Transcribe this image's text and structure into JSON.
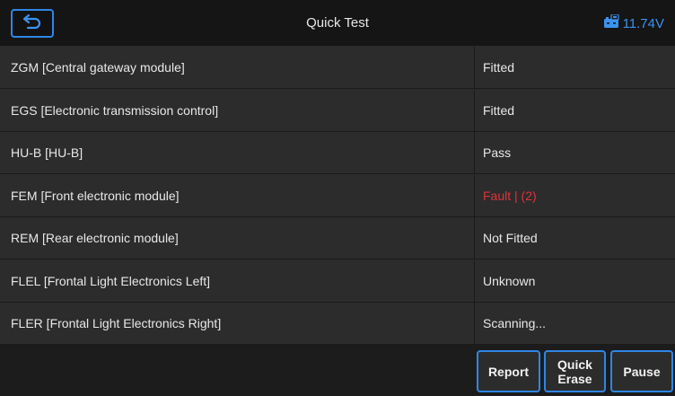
{
  "header": {
    "title": "Quick Test",
    "voltage": "11.74V"
  },
  "modules": [
    {
      "name": "ZGM [Central gateway module]",
      "status": "Fitted",
      "state": "normal"
    },
    {
      "name": "EGS [Electronic transmission control]",
      "status": "Fitted",
      "state": "normal"
    },
    {
      "name": "HU-B [HU-B]",
      "status": "Pass",
      "state": "normal"
    },
    {
      "name": "FEM [Front electronic module]",
      "status": "Fault | (2)",
      "state": "fault"
    },
    {
      "name": "REM [Rear electronic module]",
      "status": "Not Fitted",
      "state": "normal"
    },
    {
      "name": "FLEL [Frontal Light Electronics Left]",
      "status": "Unknown",
      "state": "normal"
    },
    {
      "name": "FLER [Frontal Light Electronics Right]",
      "status": "Scanning...",
      "state": "normal"
    }
  ],
  "footer": {
    "report_label": "Report",
    "quick_erase_label": "Quick\nErase",
    "pause_label": "Pause"
  },
  "colors": {
    "accent": "#2f86e6",
    "fault": "#e0323a",
    "background": "#1c1c1c",
    "row": "#2c2c2c"
  },
  "icons": {
    "back": "back-arrow-icon",
    "voltage": "car-battery-icon"
  }
}
